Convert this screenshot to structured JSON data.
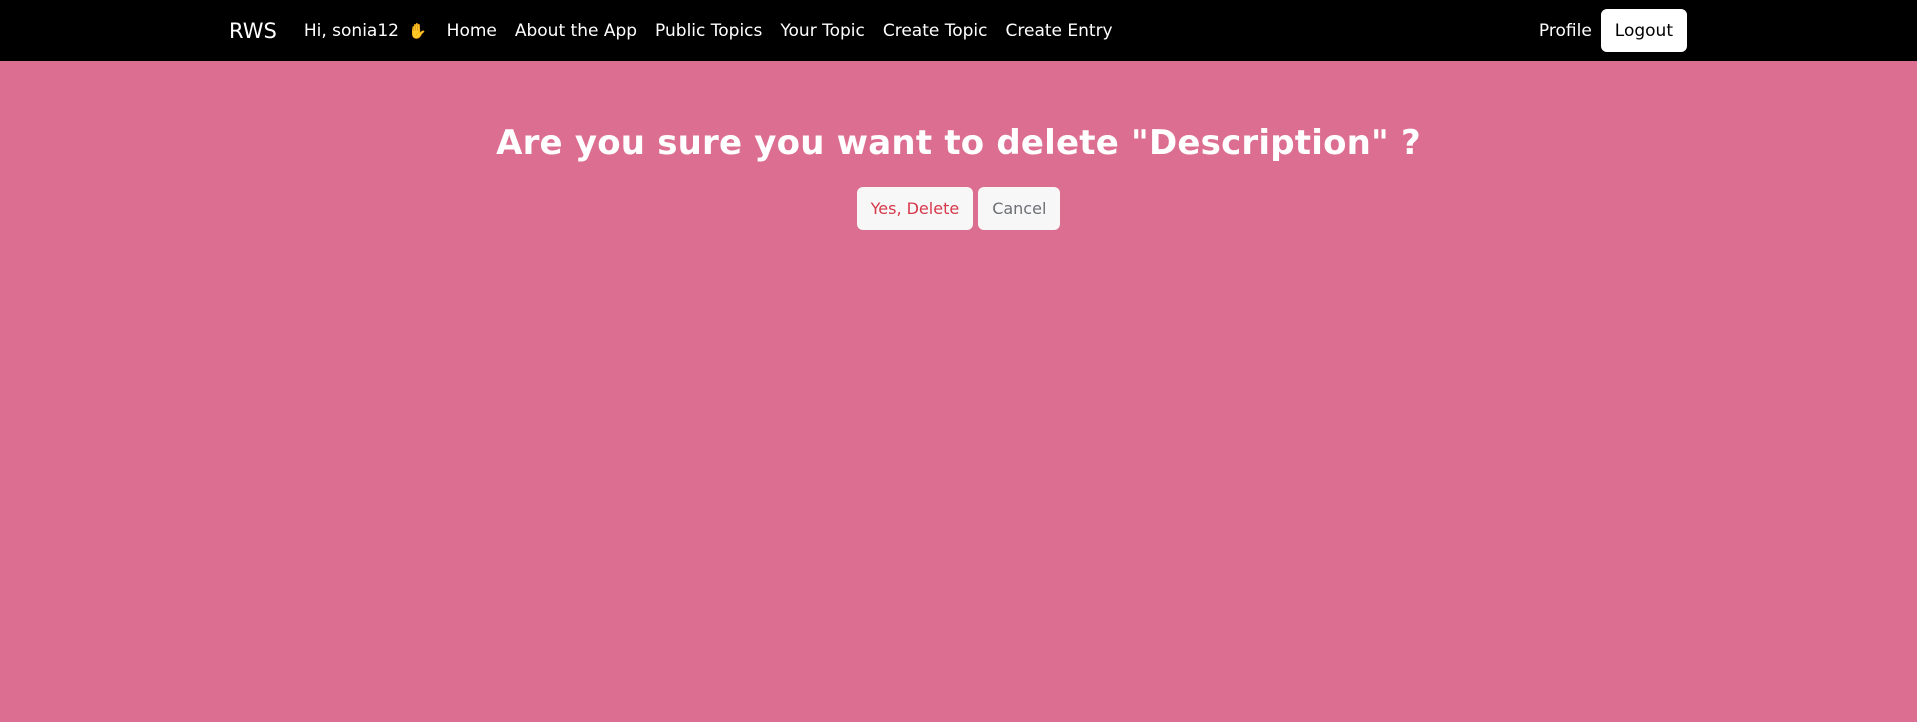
{
  "navbar": {
    "brand": "RWS",
    "greeting": "Hi, sonia12",
    "greeting_icon": "waving-hand-icon",
    "links": {
      "home": "Home",
      "about": "About the App",
      "public_topics": "Public Topics",
      "your_topic": "Your Topic",
      "create_topic": "Create Topic",
      "create_entry": "Create Entry"
    },
    "profile": "Profile",
    "logout": "Logout"
  },
  "dialog": {
    "title": "Are you sure you want to delete \"Description\" ?",
    "confirm_label": "Yes, Delete",
    "cancel_label": "Cancel"
  },
  "colors": {
    "background": "#dc6f91",
    "navbar": "#000000",
    "delete_text": "#d6384a",
    "cancel_text": "#6c6f73"
  }
}
